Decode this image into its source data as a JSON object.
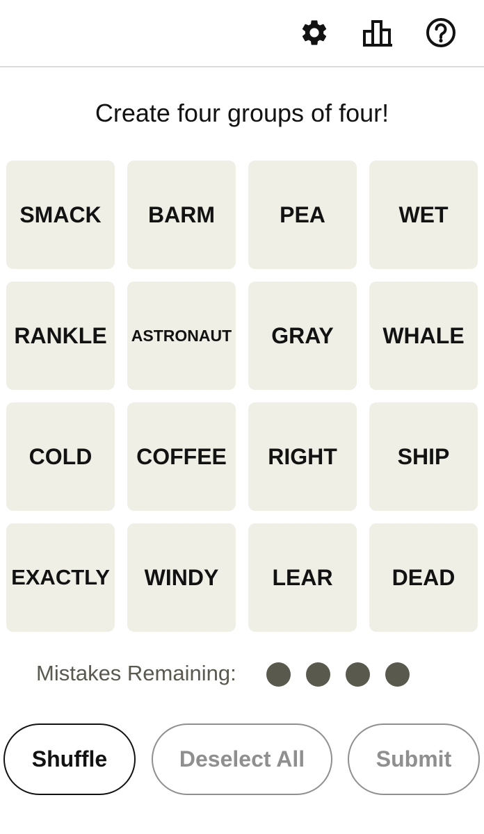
{
  "header": {
    "icons": [
      "gear-icon",
      "stats-icon",
      "help-icon"
    ]
  },
  "prompt": "Create four groups of four!",
  "tiles": [
    {
      "label": "SMACK"
    },
    {
      "label": "BARM"
    },
    {
      "label": "PEA"
    },
    {
      "label": "WET"
    },
    {
      "label": "RANKLE"
    },
    {
      "label": "ASTRONAUT"
    },
    {
      "label": "GRAY"
    },
    {
      "label": "WHALE"
    },
    {
      "label": "COLD"
    },
    {
      "label": "COFFEE"
    },
    {
      "label": "RIGHT"
    },
    {
      "label": "SHIP"
    },
    {
      "label": "EXACTLY"
    },
    {
      "label": "WINDY"
    },
    {
      "label": "LEAR"
    },
    {
      "label": "DEAD"
    }
  ],
  "mistakes": {
    "label": "Mistakes Remaining:",
    "remaining": 4
  },
  "buttons": {
    "shuffle": "Shuffle",
    "deselect": "Deselect All",
    "submit": "Submit"
  },
  "colors": {
    "tile_bg": "#efefe6",
    "dot": "#5a594e",
    "disabled": "#8f8f8f"
  }
}
